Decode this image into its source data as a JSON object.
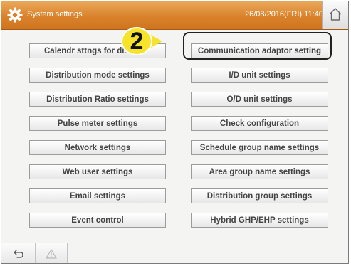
{
  "header": {
    "title": "System settings",
    "datetime": "26/08/2016(FRI) 11:40"
  },
  "buttons": {
    "calendar": "Calendr sttngs for dis",
    "communication_adaptor": "Communication adaptor setting",
    "distribution_mode": "Distribution mode settings",
    "id_unit": "I/D unit settings",
    "distribution_ratio": "Distribution Ratio settings",
    "od_unit": "O/D unit settings",
    "pulse_meter": "Pulse meter settings",
    "check_configuration": "Check configuration",
    "network": "Network settings",
    "schedule_group_name": "Schedule group name settings",
    "web_user": "Web user settings",
    "area_group_name": "Area group name settings",
    "email": "Email settings",
    "distribution_group": "Distribution group settings",
    "event_control": "Event control",
    "hybrid": "Hybrid GHP/EHP settings"
  },
  "annotation": {
    "step_number": "2",
    "marker_color": "#f6e32a"
  },
  "colors": {
    "titlebar": "#d9822b",
    "background": "#f4f4f2"
  },
  "icons": {
    "title": "gear-icon",
    "home": "home-icon",
    "back": "back-arrow-icon",
    "warning": "warning-icon"
  }
}
